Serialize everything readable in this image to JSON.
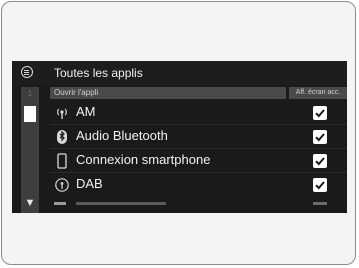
{
  "header": {
    "title": "Toutes les applis"
  },
  "columns": {
    "left": "Ouvrir l'appli",
    "right": "Aff. écran acc."
  },
  "scroll": {
    "page_indicator": "1"
  },
  "apps": [
    {
      "label": "AM",
      "icon": "radio-antenna-icon",
      "checked": true
    },
    {
      "label": "Audio Bluetooth",
      "icon": "bluetooth-icon",
      "checked": true
    },
    {
      "label": "Connexion smartphone",
      "icon": "smartphone-icon",
      "checked": true
    },
    {
      "label": "DAB",
      "icon": "dab-radio-icon",
      "checked": true
    }
  ]
}
